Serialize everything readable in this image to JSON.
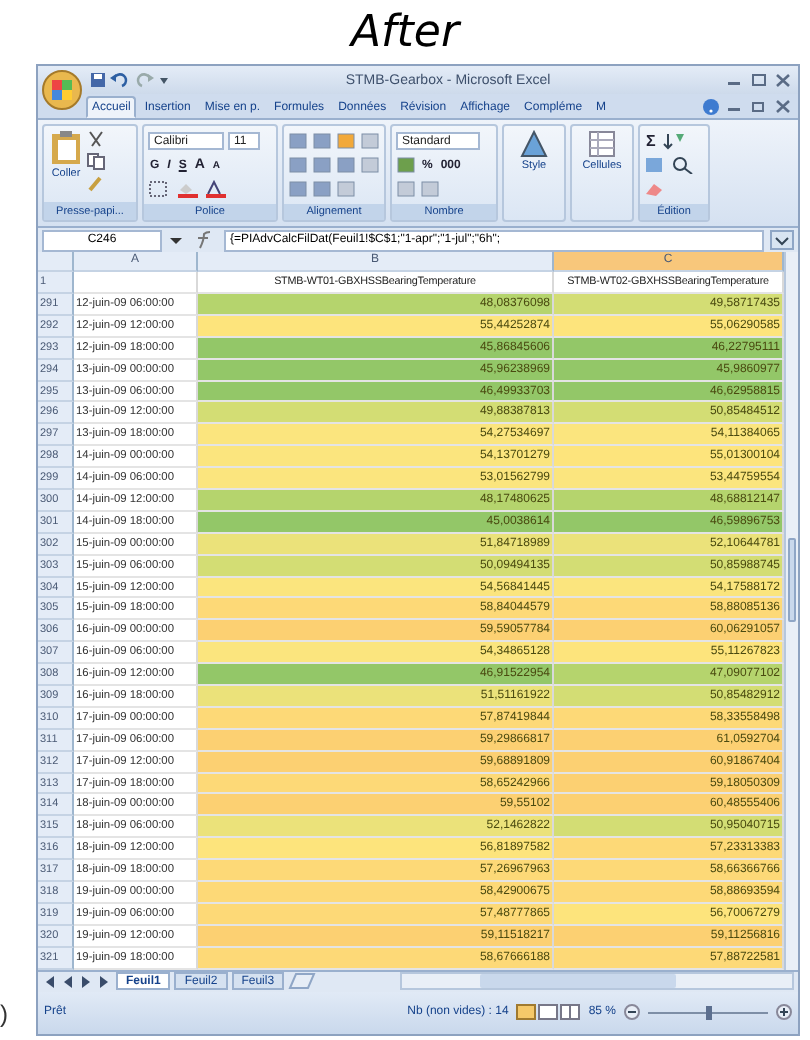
{
  "heading": "After",
  "stray_mark": ")",
  "window": {
    "title": "STMB-Gearbox - Microsoft Excel"
  },
  "tabs": [
    {
      "label": "Accueil",
      "selected": true
    },
    {
      "label": "Insertion",
      "selected": false
    },
    {
      "label": "Mise en p.",
      "selected": false
    },
    {
      "label": "Formules",
      "selected": false
    },
    {
      "label": "Données",
      "selected": false
    },
    {
      "label": "Révision",
      "selected": false
    },
    {
      "label": "Affichage",
      "selected": false
    },
    {
      "label": "Compléme",
      "selected": false
    },
    {
      "label": "M",
      "selected": false
    }
  ],
  "ribbon": {
    "clipboard": {
      "paste": "Coller",
      "label": "Presse-papi..."
    },
    "font": {
      "name": "Calibri",
      "size": "11",
      "bold": "G",
      "italic": "I",
      "underline": "S",
      "grow": "A",
      "shrink": "A",
      "label": "Police"
    },
    "alignment": {
      "label": "Alignement"
    },
    "number": {
      "format": "Standard",
      "percent": "%",
      "thousands": "000",
      "label": "Nombre"
    },
    "style": {
      "button": "Style"
    },
    "cells": {
      "button": "Cellules"
    },
    "editing": {
      "sum": "Σ",
      "label": "Édition"
    }
  },
  "formula_bar": {
    "name_box": "C246",
    "formula": "{=PIAdvCalcFilDat(Feuil1!$C$1;\"1-apr\";\"1-jul\";\"6h\";"
  },
  "sheet": {
    "columns": [
      {
        "letter": "A",
        "selected": false
      },
      {
        "letter": "B",
        "selected": false
      },
      {
        "letter": "C",
        "selected": true
      }
    ],
    "header_row": {
      "number": "1",
      "b": "STMB-WT01-GBXHSSBearingTemperature",
      "c": "STMB-WT02-GBXHSSBearingTemperature"
    },
    "rows": [
      {
        "number": "291",
        "date": "12-juin-09 06:00:00",
        "b": {
          "value": "48,08376098",
          "color": "#b5d46d"
        },
        "c": {
          "value": "49,58717435",
          "color": "#d3dd74"
        }
      },
      {
        "number": "292",
        "date": "12-juin-09 12:00:00",
        "b": {
          "value": "55,44252874",
          "color": "#fde47c"
        },
        "c": {
          "value": "55,06290585",
          "color": "#fde47c"
        }
      },
      {
        "number": "293",
        "date": "12-juin-09 18:00:00",
        "b": {
          "value": "45,86845606",
          "color": "#93c768"
        },
        "c": {
          "value": "46,22795111",
          "color": "#93c768"
        }
      },
      {
        "number": "294",
        "date": "13-juin-09 00:00:00",
        "b": {
          "value": "45,96238969",
          "color": "#93c768"
        },
        "c": {
          "value": "45,9860977",
          "color": "#93c768"
        }
      },
      {
        "number": "295",
        "date": "13-juin-09 06:00:00",
        "b": {
          "value": "46,49933703",
          "color": "#93c768"
        },
        "c": {
          "value": "46,62958815",
          "color": "#93c768"
        }
      },
      {
        "number": "296",
        "date": "13-juin-09 12:00:00",
        "b": {
          "value": "49,88387813",
          "color": "#d3dd74"
        },
        "c": {
          "value": "50,85484512",
          "color": "#d3dd74"
        }
      },
      {
        "number": "297",
        "date": "13-juin-09 18:00:00",
        "b": {
          "value": "54,27534697",
          "color": "#fbe57e"
        },
        "c": {
          "value": "54,11384065",
          "color": "#fbe57e"
        }
      },
      {
        "number": "298",
        "date": "14-juin-09 00:00:00",
        "b": {
          "value": "54,13701279",
          "color": "#fbe57e"
        },
        "c": {
          "value": "55,01300104",
          "color": "#fde47c"
        }
      },
      {
        "number": "299",
        "date": "14-juin-09 06:00:00",
        "b": {
          "value": "53,01562799",
          "color": "#fbe57e"
        },
        "c": {
          "value": "53,44759554",
          "color": "#fbe57e"
        }
      },
      {
        "number": "300",
        "date": "14-juin-09 12:00:00",
        "b": {
          "value": "48,17480625",
          "color": "#b5d46d"
        },
        "c": {
          "value": "48,68812147",
          "color": "#b5d46d"
        }
      },
      {
        "number": "301",
        "date": "14-juin-09 18:00:00",
        "b": {
          "value": "45,0038614",
          "color": "#93c768"
        },
        "c": {
          "value": "46,59896753",
          "color": "#93c768"
        }
      },
      {
        "number": "302",
        "date": "15-juin-09 00:00:00",
        "b": {
          "value": "51,84718989",
          "color": "#ebe27a"
        },
        "c": {
          "value": "52,10644781",
          "color": "#ebe27a"
        }
      },
      {
        "number": "303",
        "date": "15-juin-09 06:00:00",
        "b": {
          "value": "50,09494135",
          "color": "#d3dd74"
        },
        "c": {
          "value": "50,85988745",
          "color": "#d3dd74"
        }
      },
      {
        "number": "304",
        "date": "15-juin-09 12:00:00",
        "b": {
          "value": "54,56841445",
          "color": "#fbe57e"
        },
        "c": {
          "value": "54,17588172",
          "color": "#fbe57e"
        }
      },
      {
        "number": "305",
        "date": "15-juin-09 18:00:00",
        "b": {
          "value": "58,84044579",
          "color": "#fdd977"
        },
        "c": {
          "value": "58,88085136",
          "color": "#fdd977"
        }
      },
      {
        "number": "306",
        "date": "16-juin-09 00:00:00",
        "b": {
          "value": "59,59057784",
          "color": "#fcd072"
        },
        "c": {
          "value": "60,06291057",
          "color": "#fcd072"
        }
      },
      {
        "number": "307",
        "date": "16-juin-09 06:00:00",
        "b": {
          "value": "54,34865128",
          "color": "#fbe57e"
        },
        "c": {
          "value": "55,11267823",
          "color": "#fde47c"
        }
      },
      {
        "number": "308",
        "date": "16-juin-09 12:00:00",
        "b": {
          "value": "46,91522954",
          "color": "#93c768"
        },
        "c": {
          "value": "47,09077102",
          "color": "#b5d46d"
        }
      },
      {
        "number": "309",
        "date": "16-juin-09 18:00:00",
        "b": {
          "value": "51,51161922",
          "color": "#ebe27a"
        },
        "c": {
          "value": "50,85482912",
          "color": "#d3dd74"
        }
      },
      {
        "number": "310",
        "date": "17-juin-09 00:00:00",
        "b": {
          "value": "57,87419844",
          "color": "#fdd977"
        },
        "c": {
          "value": "58,33558498",
          "color": "#fdd977"
        }
      },
      {
        "number": "311",
        "date": "17-juin-09 06:00:00",
        "b": {
          "value": "59,29866817",
          "color": "#fcd072"
        },
        "c": {
          "value": "61,0592704",
          "color": "#fcd072"
        }
      },
      {
        "number": "312",
        "date": "17-juin-09 12:00:00",
        "b": {
          "value": "59,68891809",
          "color": "#fcd072"
        },
        "c": {
          "value": "60,91867404",
          "color": "#fcd072"
        }
      },
      {
        "number": "313",
        "date": "17-juin-09 18:00:00",
        "b": {
          "value": "58,65242966",
          "color": "#fdd977"
        },
        "c": {
          "value": "59,18050309",
          "color": "#fcd072"
        }
      },
      {
        "number": "314",
        "date": "18-juin-09 00:00:00",
        "b": {
          "value": "59,55102",
          "color": "#fcd072"
        },
        "c": {
          "value": "60,48555406",
          "color": "#fcd072"
        }
      },
      {
        "number": "315",
        "date": "18-juin-09 06:00:00",
        "b": {
          "value": "52,1462822",
          "color": "#ebe27a"
        },
        "c": {
          "value": "50,95040715",
          "color": "#d3dd74"
        }
      },
      {
        "number": "316",
        "date": "18-juin-09 12:00:00",
        "b": {
          "value": "56,81897582",
          "color": "#fde47c"
        },
        "c": {
          "value": "57,23313383",
          "color": "#fdd977"
        }
      },
      {
        "number": "317",
        "date": "18-juin-09 18:00:00",
        "b": {
          "value": "57,26967963",
          "color": "#fdd977"
        },
        "c": {
          "value": "58,66366766",
          "color": "#fdd977"
        }
      },
      {
        "number": "318",
        "date": "19-juin-09 00:00:00",
        "b": {
          "value": "58,42900675",
          "color": "#fdd977"
        },
        "c": {
          "value": "58,88693594",
          "color": "#fdd977"
        }
      },
      {
        "number": "319",
        "date": "19-juin-09 06:00:00",
        "b": {
          "value": "57,48777865",
          "color": "#fdd977"
        },
        "c": {
          "value": "56,70067279",
          "color": "#fde47c"
        }
      },
      {
        "number": "320",
        "date": "19-juin-09 12:00:00",
        "b": {
          "value": "59,11518217",
          "color": "#fcd072"
        },
        "c": {
          "value": "59,11256816",
          "color": "#fcd072"
        }
      },
      {
        "number": "321",
        "date": "19-juin-09 18:00:00",
        "b": {
          "value": "58,67666188",
          "color": "#fdd977"
        },
        "c": {
          "value": "57,88722581",
          "color": "#fdd977"
        }
      }
    ]
  },
  "sheet_tabs": [
    {
      "label": "Feuil1",
      "selected": true
    },
    {
      "label": "Feuil2",
      "selected": false
    },
    {
      "label": "Feuil3",
      "selected": false
    }
  ],
  "status_bar": {
    "mode": "Prêt",
    "count": "Nb (non vides) : 14",
    "zoom": "85 %",
    "zoom_slider": {
      "level": 0.5
    }
  }
}
